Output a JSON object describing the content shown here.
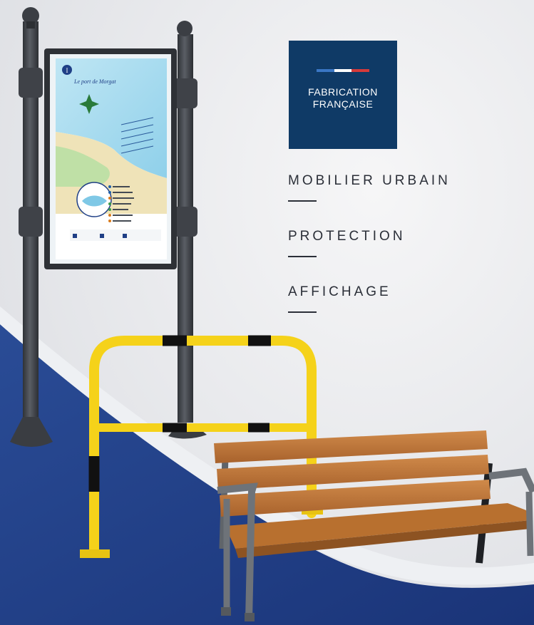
{
  "badge": {
    "line1": "FABRICATION",
    "line2": "FRANÇAISE",
    "flag_colors": [
      "#3a76c4",
      "#ffffff",
      "#d63a3a"
    ]
  },
  "categories": [
    {
      "label": "MOBILIER URBAIN"
    },
    {
      "label": "PROTECTION"
    },
    {
      "label": "AFFICHAGE"
    }
  ],
  "sign_map": {
    "title": "Le port de Morgat",
    "info_marker": "I"
  },
  "colors": {
    "brand_blue": "#0f3a66",
    "floor_blue": "#1f3f86",
    "barrier_yellow": "#f5d21a",
    "wood": "#c2783a",
    "frame_gray": "#6e7379",
    "post_gray": "#4a4e54"
  }
}
